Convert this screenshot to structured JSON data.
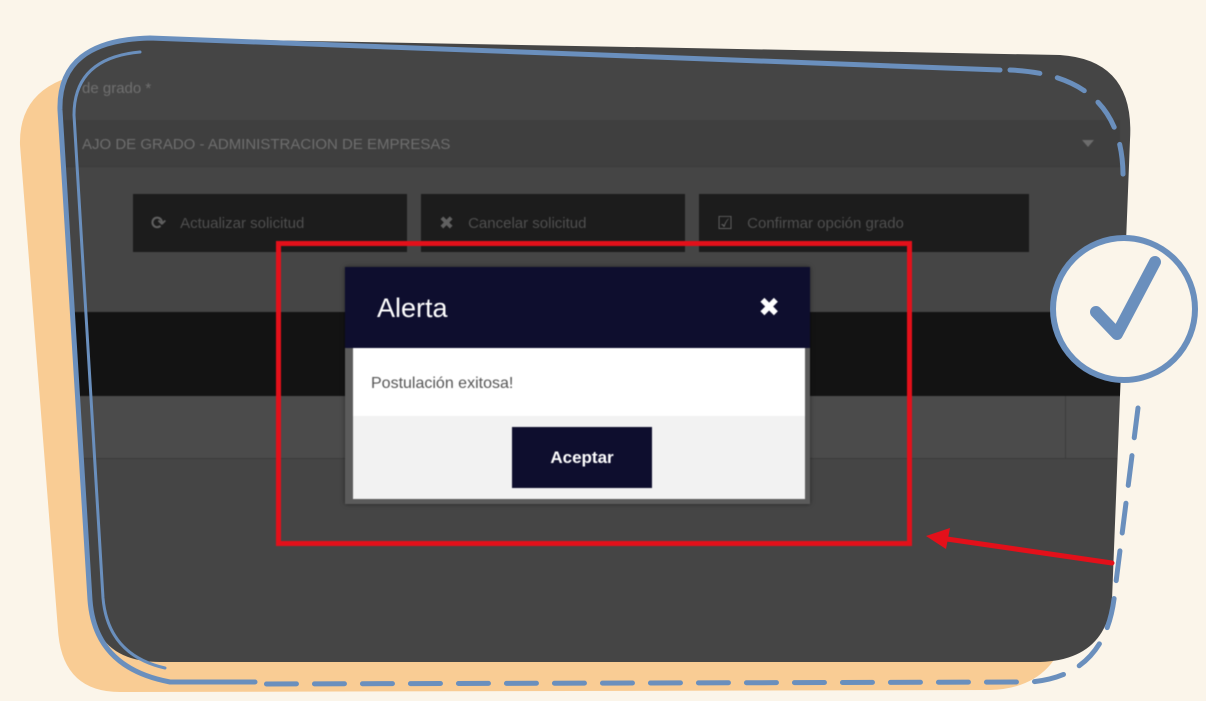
{
  "form": {
    "field_label": "de grado *",
    "select_value": "AJO DE GRADO - ADMINISTRACION DE EMPRESAS"
  },
  "actions": [
    {
      "label": "Actualizar solicitud",
      "icon": "refresh-icon",
      "glyph": "⟳"
    },
    {
      "label": "Cancelar solicitud",
      "icon": "close-icon",
      "glyph": "✖"
    },
    {
      "label": "Confirmar opción grado",
      "icon": "checkbox-icon",
      "glyph": "☑"
    }
  ],
  "modal": {
    "title": "Alerta",
    "close_glyph": "✖",
    "message": "Postulación exitosa!",
    "accept_label": "Aceptar"
  },
  "colors": {
    "background": "#fbf5ea",
    "frame_blue": "#6a8fbd",
    "shadow_orange": "#f9cc94",
    "highlight_red": "#e3101a",
    "modal_header": "#0e0e2e"
  },
  "decorations": {
    "check_badge_icon": "check-circle-icon",
    "pointer_arrow_icon": "red-arrow-icon"
  }
}
